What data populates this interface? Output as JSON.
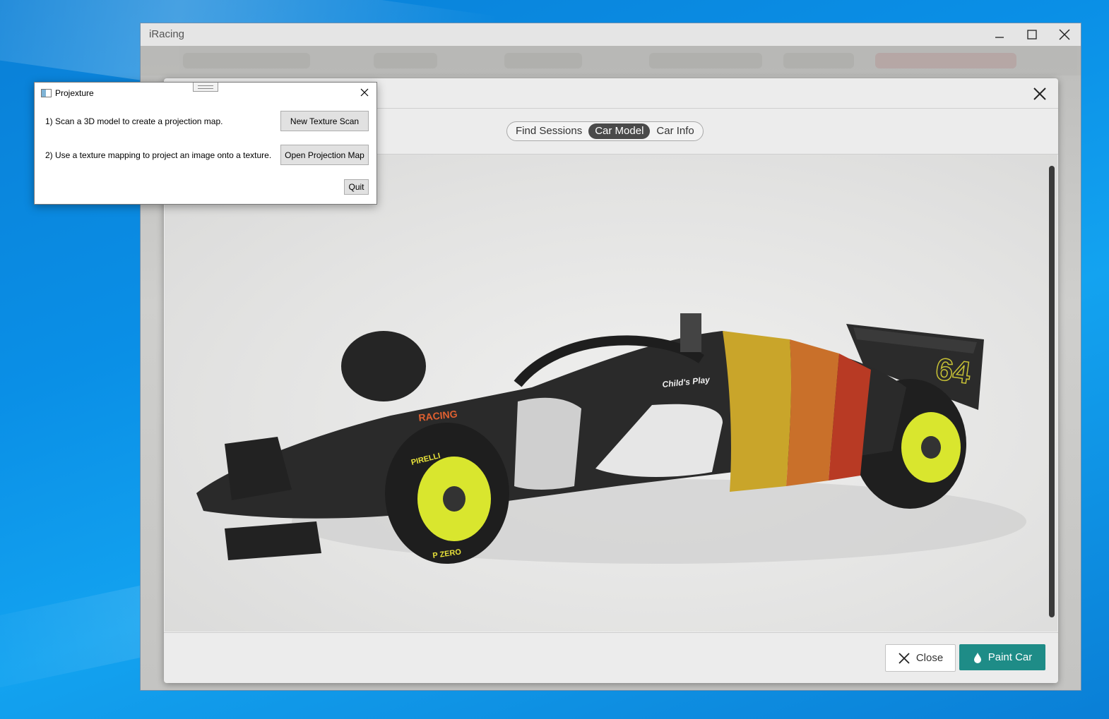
{
  "window": {
    "title": "iRacing"
  },
  "modal": {
    "tabs": [
      {
        "label": "Find Sessions",
        "active": false
      },
      {
        "label": "Car Model",
        "active": true
      },
      {
        "label": "Car Info",
        "active": false
      }
    ],
    "close_label": "Close",
    "paint_label": "Paint Car"
  },
  "car": {
    "number": "64",
    "sponsor_racing": "RACING",
    "sponsor_charity": "Child's Play",
    "tire_brand": "PIRELLI",
    "tire_model": "P ZERO"
  },
  "dialog": {
    "title": "Projexture",
    "step1_text": "1) Scan a 3D model to create a projection map.",
    "step1_button": "New Texture Scan",
    "step2_text": "2) Use a texture mapping to project an image onto a texture.",
    "step2_button": "Open Projection Map",
    "quit_button": "Quit"
  },
  "colors": {
    "accent": "#1e8c87",
    "active_tab": "#4a4a4a"
  }
}
